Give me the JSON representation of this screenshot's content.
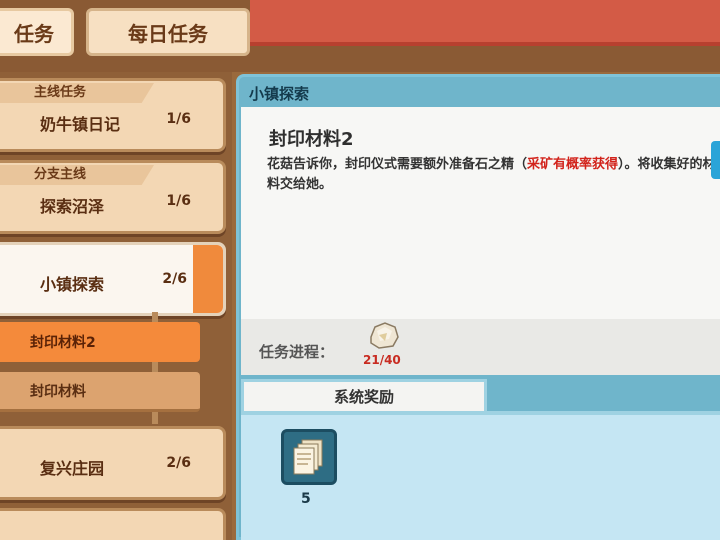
{
  "tabs": {
    "main_label": "任务",
    "daily_label": "每日任务"
  },
  "quest_list": [
    {
      "category": "主线任务",
      "name": "奶牛镇日记",
      "progress": "1/6"
    },
    {
      "category": "分支主线",
      "name": "探索沼泽",
      "progress": "1/6"
    },
    {
      "category": "",
      "name": "小镇探索",
      "progress": "2/6"
    },
    {
      "category": "",
      "name": "复兴庄园",
      "progress": "2/6"
    }
  ],
  "sub_quests": [
    {
      "name": "封印材料2",
      "state": "selected"
    },
    {
      "name": "封印材料",
      "state": "normal"
    }
  ],
  "detail": {
    "section_title": "小镇探索",
    "quest_title": "封印材料2",
    "desc_part1": "花菇告诉你，封印仪式需要额外准备石之精（",
    "desc_highlight": "采矿有概率获得",
    "desc_part2": "）。将收集好的材料交给她。",
    "progress_label": "任务进程：",
    "progress_item": "ore-stone-icon",
    "progress_count": "21/40",
    "progress_fraction": 0.525
  },
  "rewards": {
    "tab_label": "系统奖励",
    "items": [
      {
        "icon": "document-stack-icon",
        "count": "5"
      }
    ]
  },
  "colors": {
    "header_red": "#d35b46",
    "panel_blue": "#6fb5cb",
    "selected_orange": "#f48a3b",
    "highlight_red": "#d2231b"
  }
}
